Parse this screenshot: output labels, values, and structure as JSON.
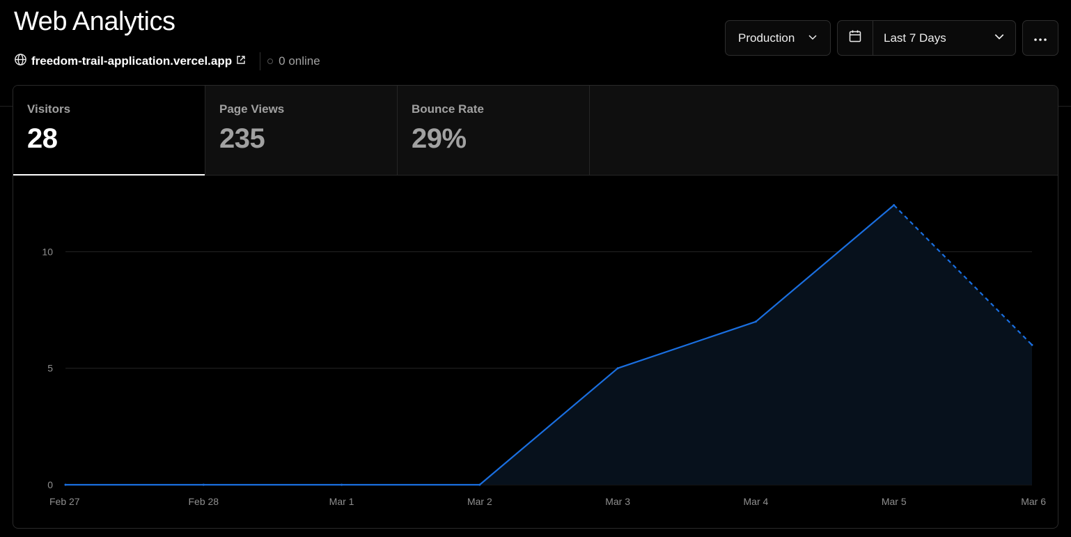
{
  "header": {
    "title": "Web Analytics",
    "site": "freedom-trail-application.vercel.app",
    "online": "0 online"
  },
  "controls": {
    "environment": "Production",
    "range": "Last 7 Days"
  },
  "metrics": [
    {
      "label": "Visitors",
      "value": "28"
    },
    {
      "label": "Page Views",
      "value": "235"
    },
    {
      "label": "Bounce Rate",
      "value": "29%"
    }
  ],
  "colors": {
    "line": "#1a6fe0",
    "area": "#07111c",
    "grid": "#262626",
    "axis_text": "#8f8f8f"
  },
  "chart_data": {
    "type": "area",
    "x": [
      "Feb 27",
      "Feb 28",
      "Mar 1",
      "Mar 2",
      "Mar 3",
      "Mar 4",
      "Mar 5",
      "Mar 6"
    ],
    "series": [
      {
        "values": [
          0,
          0,
          0,
          0,
          5,
          7,
          12,
          6
        ]
      }
    ],
    "dashed_from_index": 6,
    "yticks": [
      0,
      5,
      10
    ],
    "ylim": [
      0,
      13.3
    ],
    "grid": true
  }
}
